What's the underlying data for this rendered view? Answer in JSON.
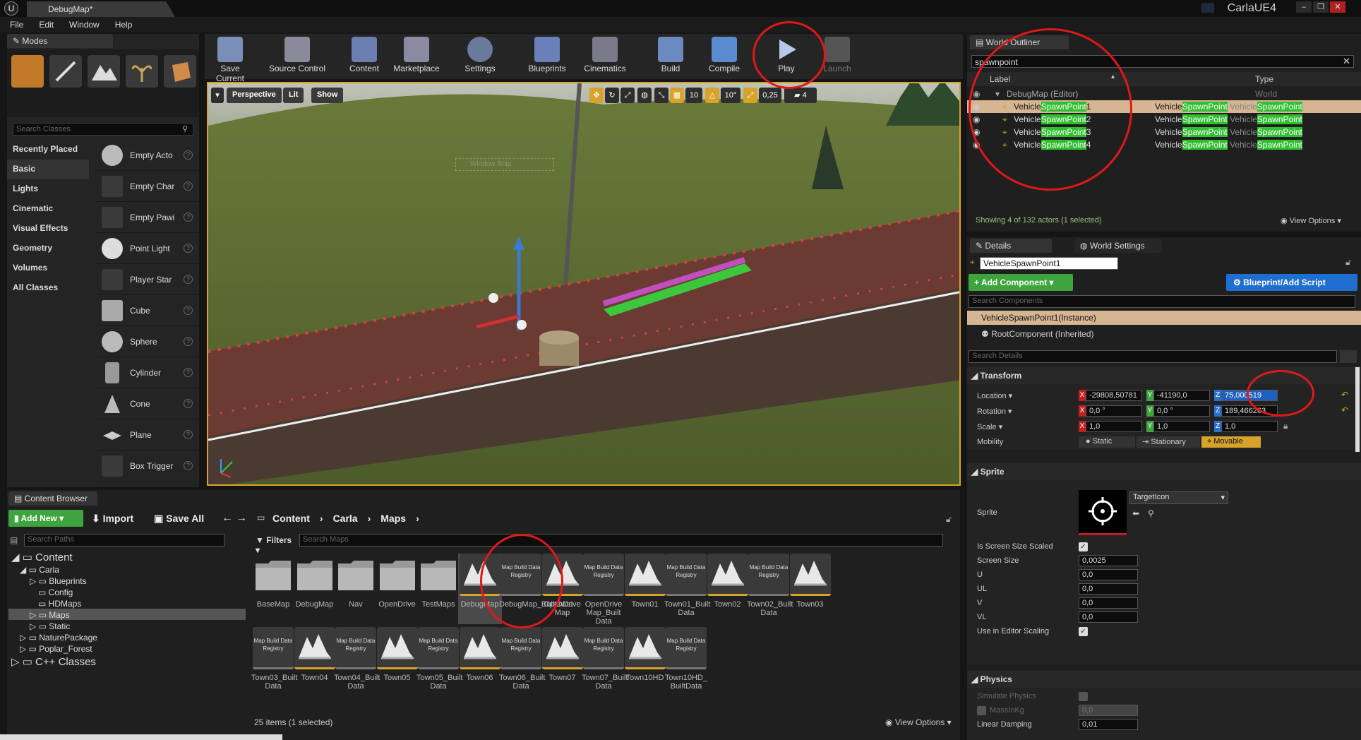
{
  "window": {
    "doc_tab": "DebugMap*",
    "project_name": "CarlaUE4"
  },
  "menu": [
    "File",
    "Edit",
    "Window",
    "Help"
  ],
  "modes": {
    "tab": "Modes",
    "search_placeholder": "Search Classes",
    "categories": [
      "Recently Placed",
      "Basic",
      "Lights",
      "Cinematic",
      "Visual Effects",
      "Geometry",
      "Volumes",
      "All Classes"
    ],
    "selected_category": "Basic",
    "classes": [
      "Empty Acto",
      "Empty Char",
      "Empty Pawi",
      "Point Light",
      "Player Star",
      "Cube",
      "Sphere",
      "Cylinder",
      "Cone",
      "Plane",
      "Box Trigger"
    ]
  },
  "toolbar": {
    "buttons": [
      "Save Current",
      "Source Control",
      "Content",
      "Marketplace",
      "Settings",
      "Blueprints",
      "Cinematics",
      "Build",
      "Compile",
      "Play",
      "Launch"
    ]
  },
  "viewport": {
    "perspective": "Perspective",
    "lit": "Lit",
    "show": "Show",
    "grid_snap": "10",
    "rot_snap": "10°",
    "scale_snap": "0,25",
    "camera_speed": "4",
    "watermark": "Window Snip"
  },
  "outliner": {
    "tab": "World Outliner",
    "search_value": "spawnpoint",
    "col_label": "Label",
    "col_type": "Type",
    "root": {
      "label": "DebugMap (Editor)",
      "type": "World"
    },
    "rows": [
      {
        "prefix": "Vehicle",
        "match": "SpawnPoint",
        "suffix": "1",
        "type_prefix": "Vehicle",
        "type_match": "SpawnPoint",
        "type_prefix2": "Vehicle",
        "type_match2": "SpawnPoint"
      },
      {
        "prefix": "Vehicle",
        "match": "SpawnPoint",
        "suffix": "2",
        "type_prefix": "Vehicle",
        "type_match": "SpawnPoint",
        "type_prefix2": "Vehicle",
        "type_match2": "SpawnPoint"
      },
      {
        "prefix": "Vehicle",
        "match": "SpawnPoint",
        "suffix": "3",
        "type_prefix": "Vehicle",
        "type_match": "SpawnPoint",
        "type_prefix2": "Vehicle",
        "type_match2": "SpawnPoint"
      },
      {
        "prefix": "Vehicle",
        "match": "SpawnPoint",
        "suffix": "4",
        "type_prefix": "Vehicle",
        "type_match": "SpawnPoint",
        "type_prefix2": "Vehicle",
        "type_match2": "SpawnPoint"
      }
    ],
    "status": "Showing 4 of 132 actors (1 selected)",
    "view_options": "View Options"
  },
  "details": {
    "tab": "Details",
    "tab2": "World Settings",
    "name": "VehicleSpawnPoint1",
    "add_component": "+ Add Component",
    "blueprint_btn": "Blueprint/Add Script",
    "search_components": "Search Components",
    "instance": "VehicleSpawnPoint1(Instance)",
    "root_component": "RootComponent (Inherited)",
    "search_details": "Search Details",
    "transform": {
      "title": "Transform",
      "location_label": "Location",
      "location": {
        "x": "-29808,50781",
        "y": "-41190,0",
        "z": "75,000519"
      },
      "rotation_label": "Rotation",
      "rotation": {
        "x": "0,0 °",
        "y": "0,0 °",
        "z": "189,466263"
      },
      "scale_label": "Scale",
      "scale": {
        "x": "1,0",
        "y": "1,0",
        "z": "1,0"
      },
      "mobility_label": "Mobility",
      "mobility": [
        "Static",
        "Stationary",
        "Movable"
      ]
    },
    "sprite": {
      "title": "Sprite",
      "sprite_label": "Sprite",
      "sprite_value": "TargetIcon",
      "screen_scaled_label": "Is Screen Size Scaled",
      "screen_size_label": "Screen Size",
      "screen_size": "0,0025",
      "u_label": "U",
      "u": "0,0",
      "ul_label": "UL",
      "ul": "0,0",
      "v_label": "V",
      "v": "0,0",
      "vl_label": "VL",
      "vl": "0,0",
      "editor_scaling_label": "Use in Editor Scaling"
    },
    "physics": {
      "title": "Physics",
      "simulate_label": "Simulate Physics",
      "mass_label": "MassInKg",
      "mass": "0,0",
      "damping_label": "Linear Damping",
      "damping": "0,01"
    }
  },
  "content_browser": {
    "tab": "Content Browser",
    "add_new": "Add New",
    "import": "Import",
    "save_all": "Save All",
    "breadcrumb": [
      "Content",
      "Carla",
      "Maps"
    ],
    "search_paths": "Search Paths",
    "filters": "Filters",
    "search_maps": "Search Maps",
    "tree": [
      "Content",
      "Carla",
      "Blueprints",
      "Config",
      "HDMaps",
      "Maps",
      "Static",
      "NaturePackage",
      "Poplar_Forest",
      "C++ Classes"
    ],
    "assets_row1": [
      {
        "label": "BaseMap",
        "kind": "folder"
      },
      {
        "label": "DebugMap",
        "kind": "folder"
      },
      {
        "label": "Nav",
        "kind": "folder"
      },
      {
        "label": "OpenDrive",
        "kind": "folder"
      },
      {
        "label": "TestMaps",
        "kind": "folder"
      },
      {
        "label": "DebugMap",
        "kind": "map"
      },
      {
        "label": "DebugMap_BuiltData",
        "kind": "reg"
      },
      {
        "label": "OpenDrive Map",
        "kind": "map"
      },
      {
        "label": "OpenDrive Map_Built Data",
        "kind": "reg"
      },
      {
        "label": "Town01",
        "kind": "map"
      },
      {
        "label": "Town01_Built Data",
        "kind": "reg"
      },
      {
        "label": "Town02",
        "kind": "map"
      },
      {
        "label": "Town02_Built Data",
        "kind": "reg"
      },
      {
        "label": "Town03",
        "kind": "map"
      }
    ],
    "assets_row2": [
      {
        "label": "Town03_Built Data",
        "kind": "reg"
      },
      {
        "label": "Town04",
        "kind": "map"
      },
      {
        "label": "Town04_Built Data",
        "kind": "reg"
      },
      {
        "label": "Town05",
        "kind": "map"
      },
      {
        "label": "Town05_Built Data",
        "kind": "reg"
      },
      {
        "label": "Town06",
        "kind": "map"
      },
      {
        "label": "Town06_Built Data",
        "kind": "reg"
      },
      {
        "label": "Town07",
        "kind": "map"
      },
      {
        "label": "Town07_Built Data",
        "kind": "reg"
      },
      {
        "label": "Town10HD",
        "kind": "map"
      },
      {
        "label": "Town10HD_ BuiltData",
        "kind": "reg"
      }
    ],
    "reg_thumb_text": "Map Build Data Registry",
    "status": "25 items (1 selected)",
    "view_options": "View Options"
  }
}
